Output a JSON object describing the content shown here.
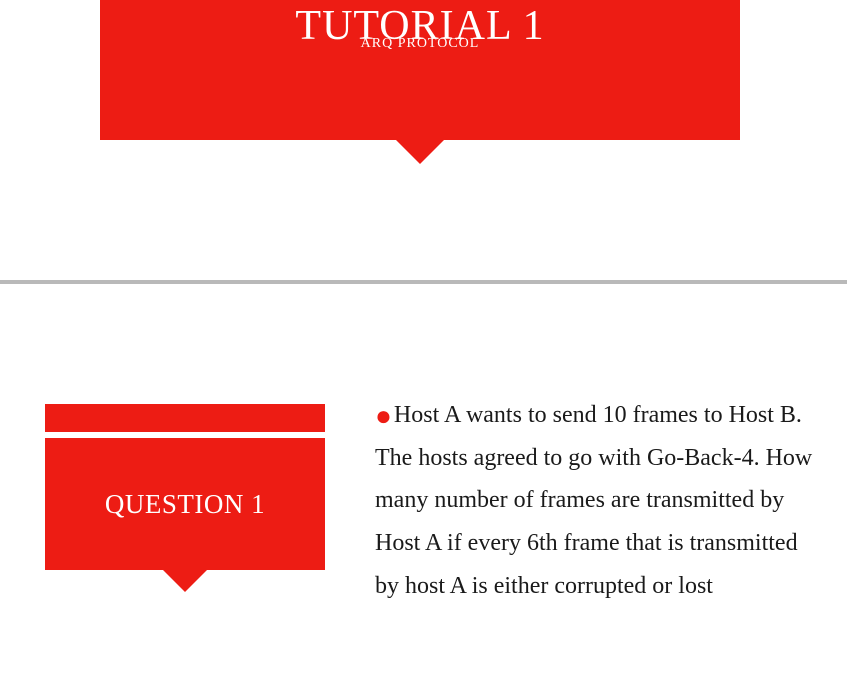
{
  "colors": {
    "accent": "#ed1c14"
  },
  "slide1": {
    "title": "TUTORIAL 1",
    "subtitle": "ARQ PROTOCOL"
  },
  "slide2": {
    "label": "QUESTION 1",
    "body": "Host A wants to send 10 frames to Host B. The hosts agreed to go with Go-Back-4. How many number of frames are transmitted by Host A if every 6th frame that is transmitted by host A is either corrupted or lost"
  }
}
